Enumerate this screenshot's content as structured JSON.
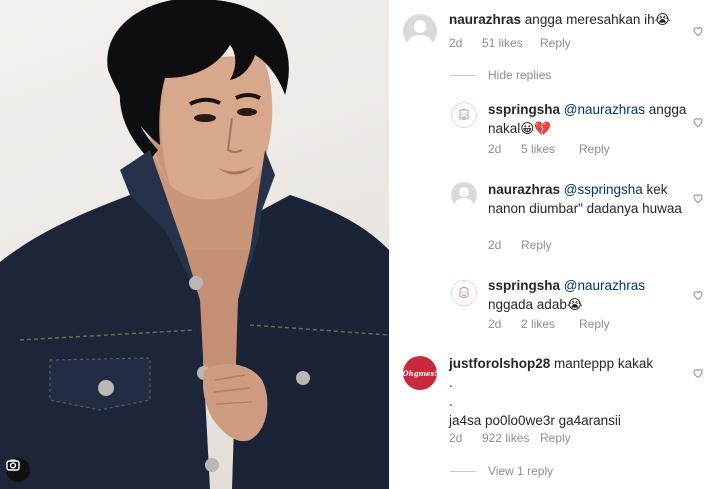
{
  "post": {
    "image_alt": "portrait photo",
    "badge_icon": "camera-icon"
  },
  "comments": [
    {
      "username": "naurazhras",
      "mention": "",
      "text": "angga meresahkan ih😭",
      "time": "2d",
      "likes": "51 likes",
      "reply_label": "Reply",
      "avatar": "default-avatar"
    },
    {
      "username": "sspringsha",
      "mention": "@naurazhras",
      "text": " angga nakal😀💔",
      "time": "2d",
      "likes": "5 likes",
      "reply_label": "Reply",
      "avatar": "sketch-avatar"
    },
    {
      "username": "naurazhras",
      "mention": "@sspringsha",
      "text": " kek nanon diumbar\" dadanya huwaa",
      "time": "2d",
      "likes": "",
      "reply_label": "Reply",
      "avatar": "default-avatar"
    },
    {
      "username": "sspringsha",
      "mention": "@naurazhras",
      "text": " nggada adab😭",
      "time": "2d",
      "likes": "2 likes",
      "reply_label": "Reply",
      "avatar": "sketch-avatar"
    },
    {
      "username": "justforolshop28",
      "mention": "",
      "text": "manteppp kakak",
      "extra_lines": [
        ".",
        ".",
        "ja4sa po0lo0we3r ga4aransii"
      ],
      "time": "2d",
      "likes": "922 likes",
      "reply_label": "Reply",
      "avatar": "brand-avatar",
      "avatar_text": "Ohgmes!"
    }
  ],
  "thread_controls": {
    "hide_replies": "Hide replies",
    "view_replies": "View 1 reply"
  },
  "colors": {
    "username": "#262626",
    "mention": "#00376b",
    "meta": "#8e8e8e",
    "heart_outline": "#8e8e8e"
  }
}
